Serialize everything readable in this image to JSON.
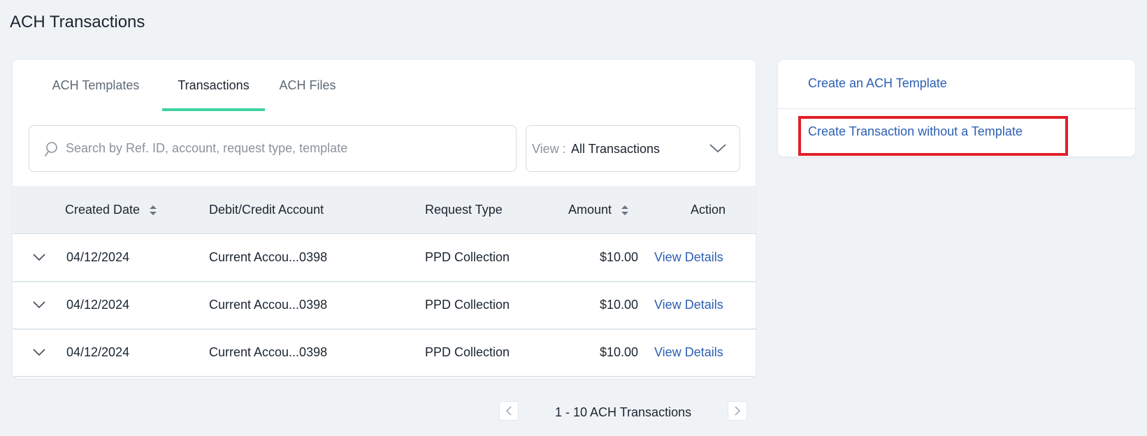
{
  "page": {
    "title": "ACH Transactions"
  },
  "tabs": [
    {
      "label": "ACH Templates",
      "active": false
    },
    {
      "label": "Transactions",
      "active": true
    },
    {
      "label": "ACH Files",
      "active": false
    }
  ],
  "search": {
    "placeholder": "Search by Ref. ID, account, request type, template",
    "value": ""
  },
  "view_filter": {
    "label": "View :",
    "value": "All Transactions"
  },
  "table": {
    "columns": {
      "created_date": "Created Date",
      "account": "Debit/Credit Account",
      "request_type": "Request Type",
      "amount": "Amount",
      "action": "Action"
    },
    "rows": [
      {
        "date": "04/12/2024",
        "account": "Current Accou...0398",
        "request_type": "PPD Collection",
        "amount": "$10.00",
        "action": "View Details"
      },
      {
        "date": "04/12/2024",
        "account": "Current Accou...0398",
        "request_type": "PPD Collection",
        "amount": "$10.00",
        "action": "View Details"
      },
      {
        "date": "04/12/2024",
        "account": "Current Accou...0398",
        "request_type": "PPD Collection",
        "amount": "$10.00",
        "action": "View Details"
      }
    ]
  },
  "pagination": {
    "summary": "1 - 10 ACH Transactions"
  },
  "side_panel": {
    "create_template": "Create an ACH Template",
    "create_transaction": "Create Transaction without a Template"
  },
  "colors": {
    "accent_tab": "#3fd2a0",
    "link": "#2d5fb3",
    "highlight": "#e0202a",
    "background": "#f0f3f6"
  },
  "icons": {
    "search": "search-icon",
    "view_dropdown": "chevron-down-icon",
    "sort": "sort-icon",
    "row_expand": "chevron-down-icon",
    "prev": "chevron-left-icon",
    "next": "chevron-right-icon"
  }
}
